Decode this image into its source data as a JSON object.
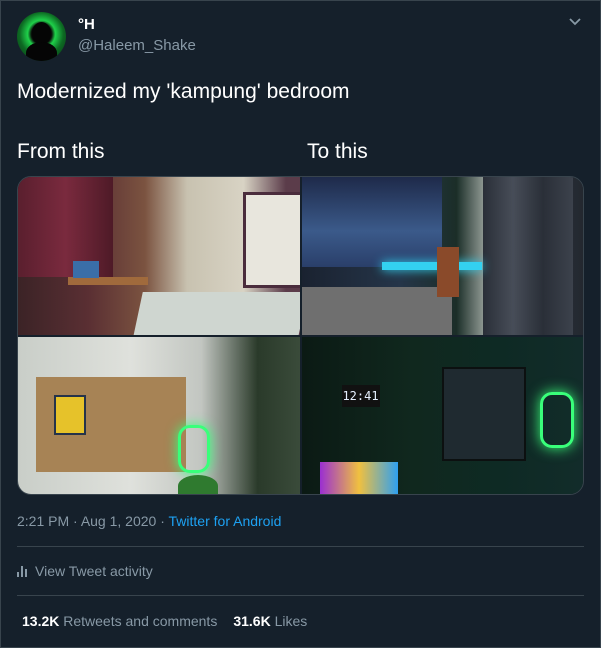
{
  "author": {
    "name": "°H",
    "handle": "@Haleem_Shake"
  },
  "tweet": {
    "text": "Modernized my 'kampung' bedroom",
    "caption_left": "From this",
    "caption_right": "To this",
    "clock_display": "12:41"
  },
  "meta": {
    "time": "2:21 PM",
    "separator1": " · ",
    "date": "Aug 1, 2020",
    "separator2": " · ",
    "source": "Twitter for Android"
  },
  "activity": {
    "label": "View Tweet activity"
  },
  "stats": {
    "retweets_count": "13.2K",
    "retweets_label": " Retweets and comments",
    "likes_count": "31.6K",
    "likes_label": " Likes"
  },
  "colors": {
    "background": "#15202b",
    "secondary_text": "#8899a6",
    "accent": "#1da1f2",
    "border": "#38444d"
  }
}
